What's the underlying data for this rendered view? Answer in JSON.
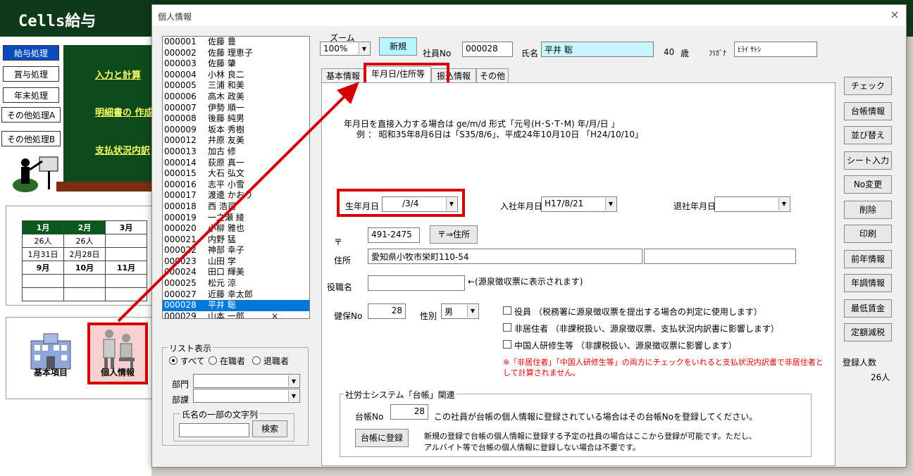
{
  "background": {
    "app_title": "Cells給与",
    "menu": [
      "給与処理",
      "賞与処理",
      "年末処理",
      "その他処理A",
      "その他処理B"
    ],
    "links": [
      "入力と計算",
      "明細書の 作成",
      "支払状況内訳"
    ],
    "calendar": {
      "row1": [
        "1月",
        "2月",
        "3月"
      ],
      "row2": [
        "26人",
        "26人",
        ""
      ],
      "row3": [
        "1月31日",
        "2月28日",
        ""
      ],
      "row4": [
        "9月",
        "10月",
        "11月"
      ]
    },
    "icons": {
      "basic_label": "基本項目",
      "personal_label": "個人情報"
    }
  },
  "dialog": {
    "title": "個人情報",
    "close": "×",
    "zoom_label": "ズーム",
    "zoom_value": "100%",
    "new_button": "新規",
    "emp_no_label": "社員No",
    "emp_no_value": "000028",
    "name_label": "氏名",
    "name_value": "平井 聡",
    "age_value": "40",
    "age_unit": "歳",
    "furigana_label": "ﾌﾘｶﾞﾅ",
    "furigana_value": "ﾋﾗｲ ｻﾄｼ",
    "employees": [
      {
        "no": "000001",
        "name": "佐藤 豊"
      },
      {
        "no": "000002",
        "name": "佐藤 理恵子"
      },
      {
        "no": "000003",
        "name": "佐藤 肇"
      },
      {
        "no": "000004",
        "name": "小林 良二"
      },
      {
        "no": "000005",
        "name": "三浦  和美"
      },
      {
        "no": "000006",
        "name": "高木 政美"
      },
      {
        "no": "000007",
        "name": "伊勢  順一"
      },
      {
        "no": "000008",
        "name": "後藤 純男"
      },
      {
        "no": "000009",
        "name": "坂本 秀樹"
      },
      {
        "no": "000012",
        "name": "井原 友美"
      },
      {
        "no": "000013",
        "name": "加古 修"
      },
      {
        "no": "000014",
        "name": "荻原 真一"
      },
      {
        "no": "000015",
        "name": "大石 弘文"
      },
      {
        "no": "000016",
        "name": "志平 小雪"
      },
      {
        "no": "000017",
        "name": "渡邊 かおり"
      },
      {
        "no": "000018",
        "name": "西 浩司"
      },
      {
        "no": "000019",
        "name": "一之瀬 綾"
      },
      {
        "no": "000020",
        "name": "小柳 雅也"
      },
      {
        "no": "000021",
        "name": "内野 猛"
      },
      {
        "no": "000022",
        "name": "神部 幸子"
      },
      {
        "no": "000023",
        "name": "山田 学"
      },
      {
        "no": "000024",
        "name": "田口 輝美"
      },
      {
        "no": "000025",
        "name": "松元 涼"
      },
      {
        "no": "000027",
        "name": "近藤 幸太郎"
      },
      {
        "no": "000028",
        "name": "平井 聡"
      },
      {
        "no": "000029",
        "name": "山本 一郎"
      }
    ],
    "emp_last_mark": "×",
    "tabs": [
      "基本情報",
      "年月日/住所等",
      "振込情報",
      "その他"
    ],
    "hint_line1": "年月日を直接入力する場合は ge/m/d  形式「元号(H･S･T･M)  年/月/日 」",
    "hint_line2": "例  ：  昭和35年8月6日は「S35/8/6」、平成24年10月10日 「H24/10/10」",
    "birth_label": "生年月日",
    "birth_value": "/3/4",
    "hire_label": "入社年月日",
    "hire_value": "H17/8/21",
    "retire_label": "退社年月日",
    "retire_value": "",
    "postal_mark": "〒",
    "postal_value": "491-2475",
    "postal_button": "〒⇒住所",
    "address_label": "住所",
    "address_value": "愛知県小牧市栄町110-54",
    "title_label": "役職名",
    "title_note": "←(源泉徴収票に表示されます)",
    "health_label": "健保No",
    "health_value": "28",
    "gender_label": "性別",
    "gender_value": "男",
    "chk_officer": "役員   （税務署に源泉徴収票を提出する場合の判定に使用します）",
    "chk_nonres": "非居住者   （非課税扱い、源泉徴収票、支払状況内訳書に影響します）",
    "chk_trainee": "中国人研修生等   （非課税扱い、源泉徴収票に影響します）",
    "warn_line1": "※「非居住者」「中国人研修生等」の両方にチェックをいれると支払状況内訳書で非居住者と",
    "warn_line2": "して計算されません。",
    "group_title": "社労士システム「台帳」関連",
    "ledger_label": "台帳No",
    "ledger_value": "28",
    "ledger_note": "この社員が台帳の個人情報に登録されている場合はその台帳Noを登録してください。",
    "ledger_button": "台帳に登録",
    "ledger_note2a": "新規の登録で台帳の個人情報に登録する予定の社員の場合はここから登録が可能です。ただし、",
    "ledger_note2b": "アルバイト等で台帳の個人情報に登録しない場合は不要です。",
    "list_group": "リスト表示",
    "radio_all": "すべて",
    "radio_active": "在職者",
    "radio_retired": "退職者",
    "dept_label": "部門",
    "section_label": "部課",
    "search_group": "氏名の一部の文字列",
    "search_button": "検索",
    "side_buttons": [
      "チェック",
      "台帳情報",
      "並び替え",
      "シート入力",
      "No変更",
      "削除",
      "印刷",
      "前年情報",
      "年調情報",
      "最低賃金",
      "定額減税"
    ],
    "count_label": "登録人数",
    "count_value": "26人"
  },
  "colors": {
    "highlight": "#d40000",
    "selected": "#0078d7",
    "name_field": "#c8f4ff"
  }
}
